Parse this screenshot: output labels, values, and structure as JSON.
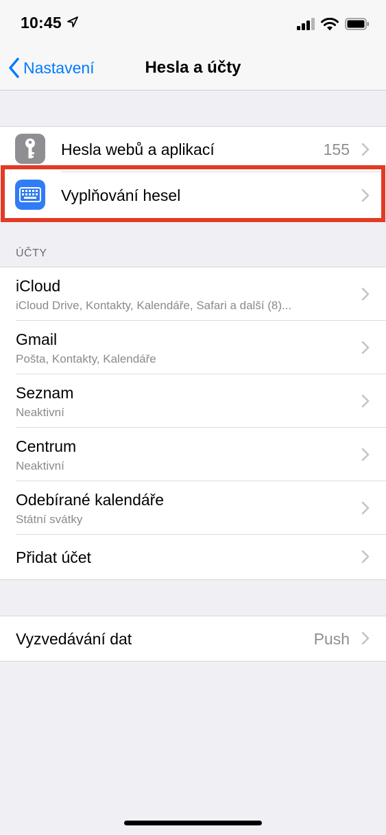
{
  "status_bar": {
    "time": "10:45"
  },
  "nav": {
    "back_label": "Nastavení",
    "title": "Hesla a účty"
  },
  "passwords_group": {
    "items": [
      {
        "label": "Hesla webů a aplikací",
        "value": "155",
        "icon": "key-icon",
        "icon_color": "#8e8e93"
      },
      {
        "label": "Vyplňování hesel",
        "icon": "keyboard-icon",
        "icon_color": "#2f7cf6"
      }
    ]
  },
  "accounts": {
    "header": "ÚČTY",
    "items": [
      {
        "label": "iCloud",
        "sublabel": "iCloud Drive, Kontakty, Kalendáře, Safari a další (8)..."
      },
      {
        "label": "Gmail",
        "sublabel": "Pošta, Kontakty, Kalendáře"
      },
      {
        "label": "Seznam",
        "sublabel": "Neaktivní"
      },
      {
        "label": "Centrum",
        "sublabel": "Neaktivní"
      },
      {
        "label": "Odebírané kalendáře",
        "sublabel": "Státní svátky"
      },
      {
        "label": "Přidat účet"
      }
    ]
  },
  "fetch_group": {
    "label": "Vyzvedávání dat",
    "value": "Push"
  },
  "colors": {
    "accent": "#007aff",
    "highlight": "#e33a24"
  }
}
